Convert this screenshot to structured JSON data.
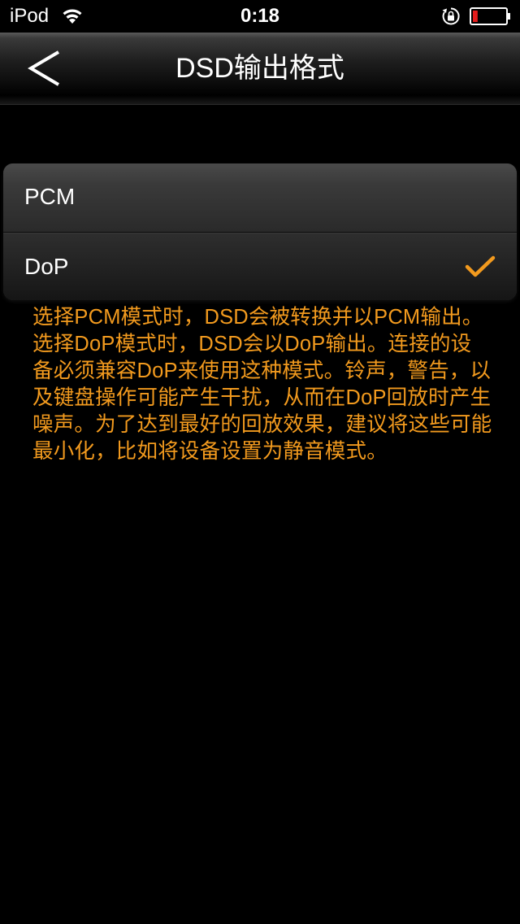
{
  "status_bar": {
    "carrier": "iPod",
    "time": "0:18",
    "wifi_icon": "wifi-icon",
    "lock_icon": "rotation-lock-icon",
    "battery_icon": "battery-low-icon",
    "battery_level": 0.15
  },
  "nav": {
    "back_icon": "chevron-left-icon",
    "title": "DSD输出格式"
  },
  "options": {
    "items": [
      {
        "label": "PCM",
        "selected": false
      },
      {
        "label": "DoP",
        "selected": true
      }
    ],
    "check_icon": "checkmark-icon",
    "check_color": "#f29a1e"
  },
  "description": {
    "text": "选择PCM模式时，DSD会被转换并以PCM输出。选择DoP模式时，DSD会以DoP输出。连接的设备必须兼容DoP来使用这种模式。铃声，警告，以及键盘操作可能产生干扰，从而在DoP回放时产生噪声。为了达到最好的回放效果，建议将这些可能最小化，比如将设备设置为静音模式。",
    "color": "#f29a1e"
  }
}
